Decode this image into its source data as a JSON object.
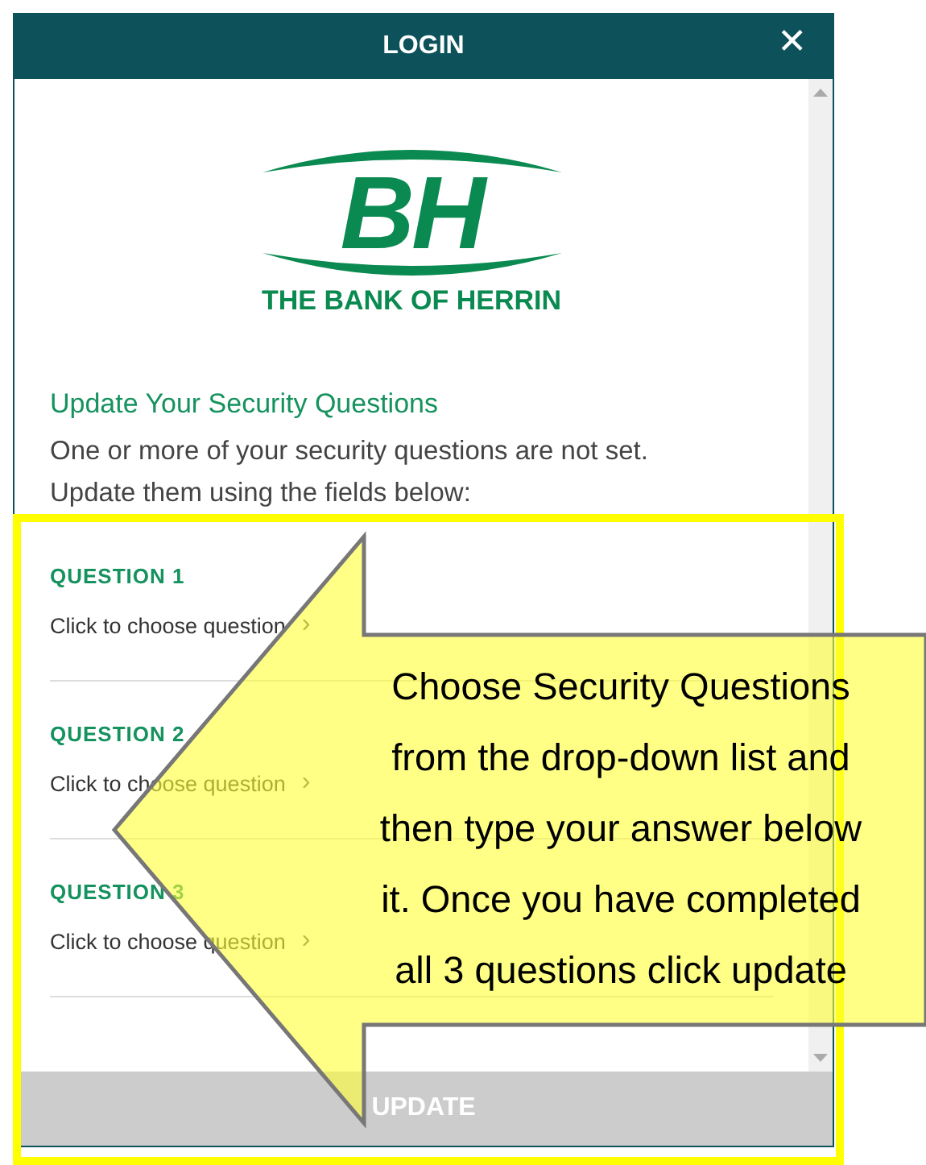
{
  "window": {
    "title": "LOGIN",
    "close": "✕"
  },
  "logo": {
    "monogram": "BH",
    "name": "THE BANK OF HERRIN"
  },
  "heading": "Update Your Security Questions",
  "intro": [
    "One or more of your security questions are not set.",
    "Update them using the fields below:"
  ],
  "questions": [
    {
      "label": "QUESTION 1",
      "link": "Click to choose question",
      "chevron": "›"
    },
    {
      "label": "QUESTION 2",
      "link": "Click to choose question",
      "chevron": "›"
    },
    {
      "label": "QUESTION 3",
      "link": "Click to choose question",
      "chevron": "›"
    }
  ],
  "update_button": {
    "label": "UPDATE",
    "disabled": true
  },
  "callout": {
    "lines": [
      "Choose Security Questions",
      "from the drop-down list and",
      "then type your answer below",
      "it. Once you have completed",
      "all 3 questions click update"
    ]
  }
}
